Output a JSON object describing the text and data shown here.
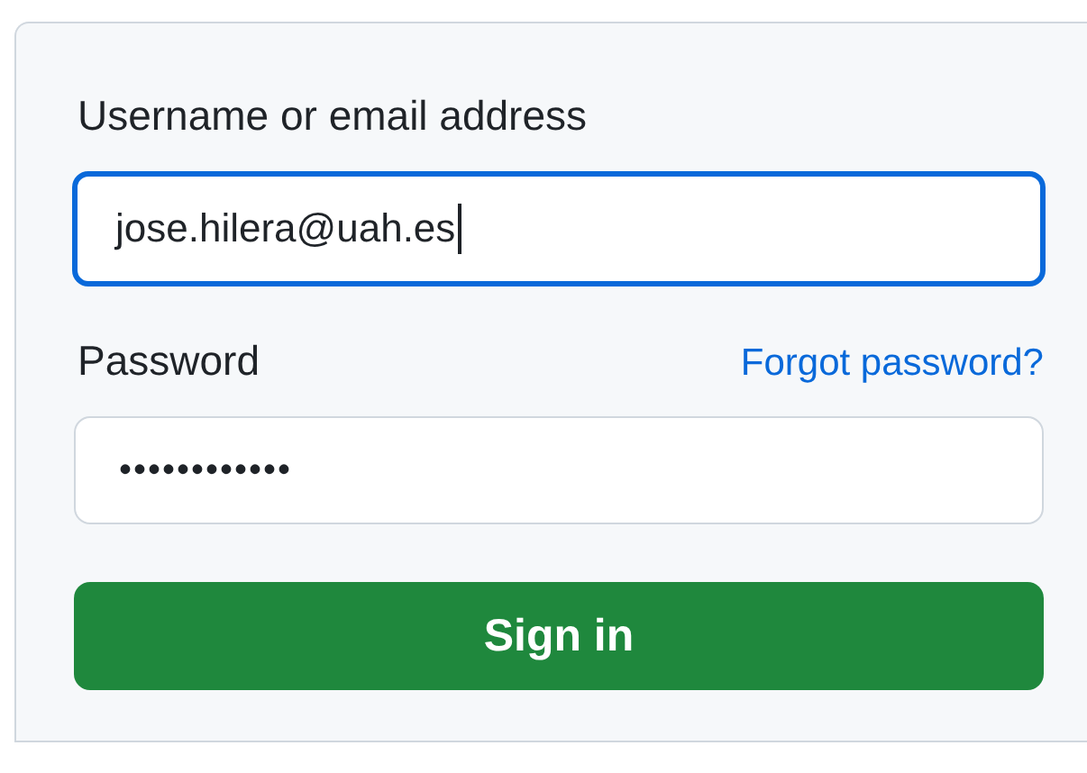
{
  "login_form": {
    "fields": [
      {
        "kind": "text",
        "label": "Username or email address",
        "value": "jose.hilera@uah.es",
        "focused": true
      },
      {
        "kind": "password",
        "label": "Password",
        "link": "Forgot password?",
        "value": "••••••••••••",
        "focused": false
      }
    ],
    "submit_button": "Sign in"
  }
}
